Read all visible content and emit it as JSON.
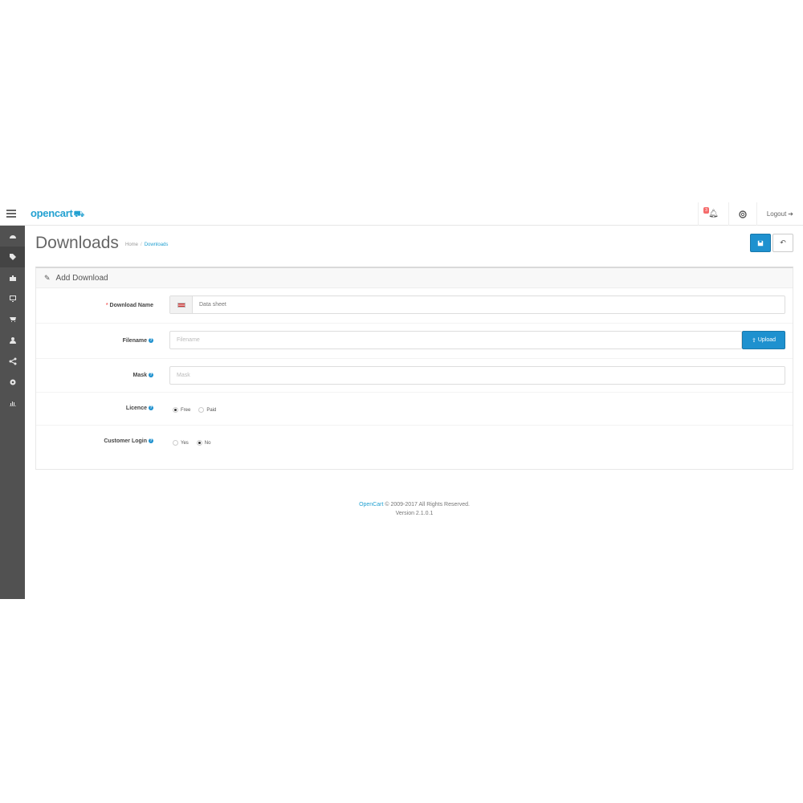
{
  "header": {
    "logo_text": "opencart",
    "notification_count": "3",
    "logout_label": "Logout"
  },
  "sidebar": {
    "items": [
      {
        "icon": "dashboard-icon"
      },
      {
        "icon": "tag-icon"
      },
      {
        "icon": "puzzle-icon"
      },
      {
        "icon": "monitor-icon"
      },
      {
        "icon": "cart-icon"
      },
      {
        "icon": "user-icon"
      },
      {
        "icon": "share-icon"
      },
      {
        "icon": "cog-icon"
      },
      {
        "icon": "bar-chart-icon"
      }
    ]
  },
  "page": {
    "title": "Downloads",
    "breadcrumb_home": "Home",
    "breadcrumb_current": "Downloads"
  },
  "panel": {
    "heading": "Add Download"
  },
  "form": {
    "download_name_label": "Download Name",
    "download_name_value": "Data sheet",
    "filename_label": "Filename",
    "filename_placeholder": "Filename",
    "upload_label": "Upload",
    "mask_label": "Mask",
    "mask_placeholder": "Mask",
    "licence_label": "Licence",
    "licence_options": [
      "Free",
      "Paid"
    ],
    "licence_selected": "Free",
    "customer_login_label": "Customer Login",
    "customer_login_options": [
      "Yes",
      "No"
    ],
    "customer_login_selected": "No"
  },
  "footer": {
    "brand": "OpenCart",
    "copyright": "© 2009-2017 All Rights Reserved.",
    "version": "Version 2.1.0.1"
  },
  "colors": {
    "accent": "#1e91cf",
    "sidebar": "#515151",
    "badge": "#f56b6b"
  }
}
